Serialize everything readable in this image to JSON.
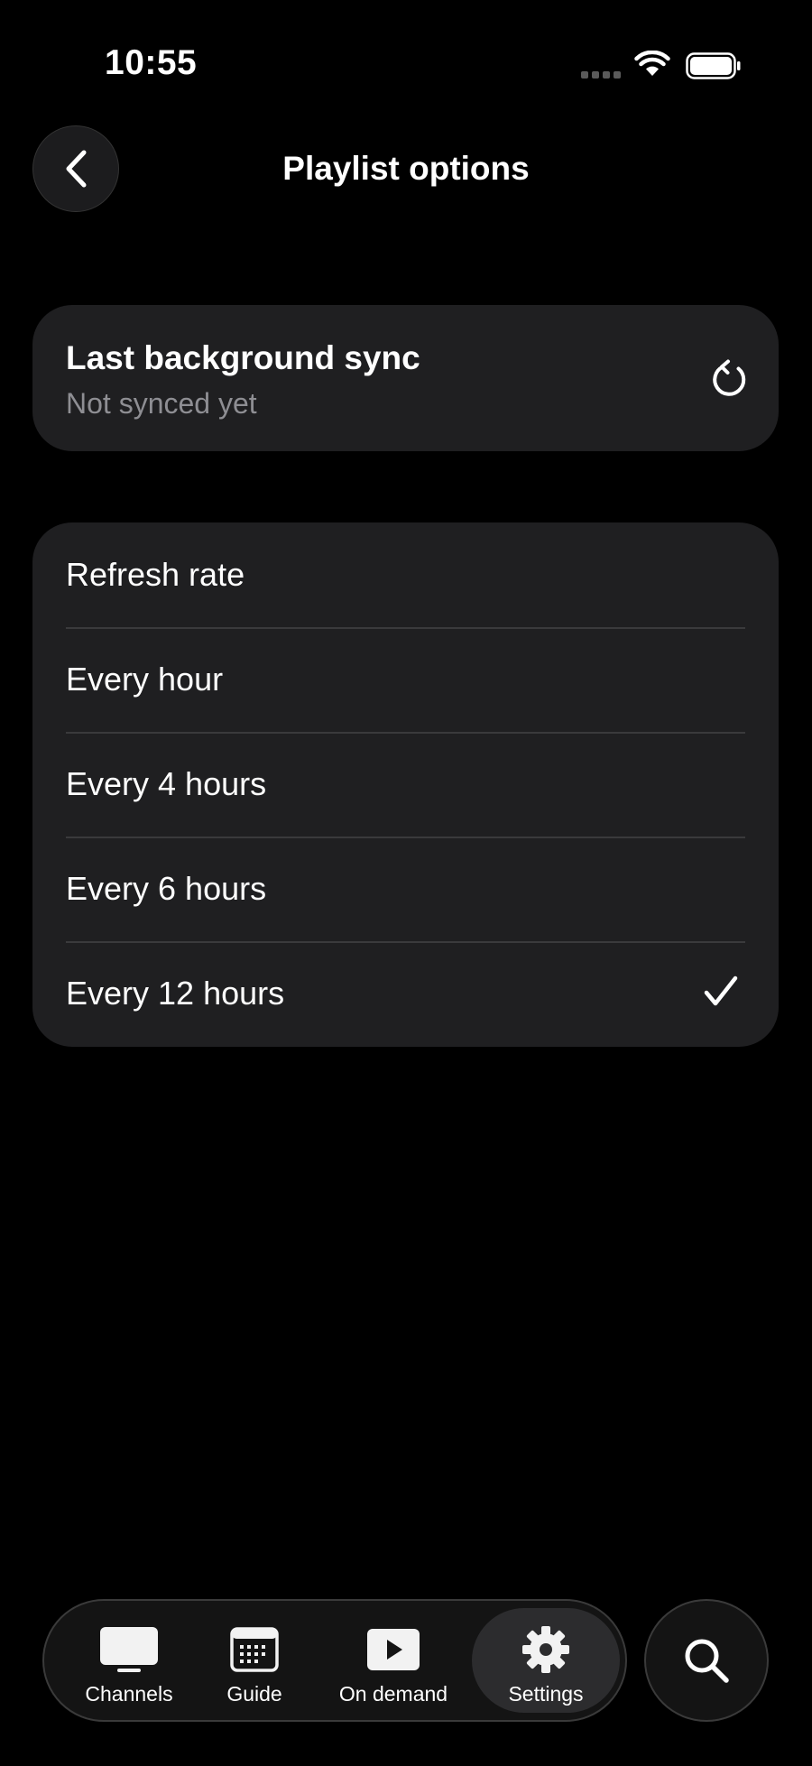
{
  "status_bar": {
    "time": "10:55"
  },
  "header": {
    "title": "Playlist options",
    "back_icon": "chevron-left-icon"
  },
  "sync": {
    "title": "Last background sync",
    "status": "Not synced yet",
    "icon": "refresh-icon"
  },
  "refresh_rate": {
    "heading": "Refresh rate",
    "options": [
      {
        "label": "Every hour",
        "selected": false
      },
      {
        "label": "Every 4 hours",
        "selected": false
      },
      {
        "label": "Every 6 hours",
        "selected": false
      },
      {
        "label": "Every 12 hours",
        "selected": true
      }
    ]
  },
  "tab_bar": {
    "tabs": [
      {
        "label": "Channels",
        "icon": "tv-icon"
      },
      {
        "label": "Guide",
        "icon": "calendar-icon"
      },
      {
        "label": "On demand",
        "icon": "play-icon"
      },
      {
        "label": "Settings",
        "icon": "gear-icon",
        "active": true
      }
    ],
    "search_icon": "search-icon"
  },
  "colors": {
    "background": "#000000",
    "card": "#1f1f21",
    "secondary_text": "#8e8e93",
    "separator": "#3a3a3c"
  }
}
